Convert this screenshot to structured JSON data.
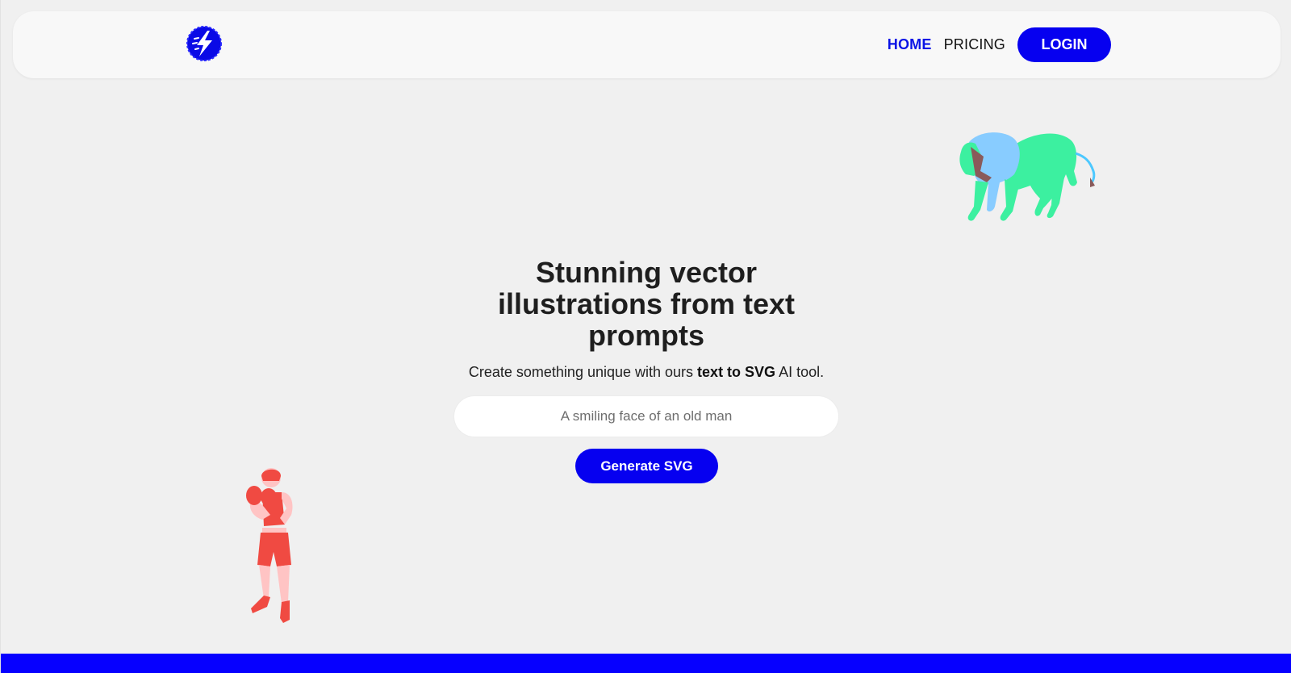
{
  "nav": {
    "home": "HOME",
    "pricing": "PRICING",
    "login": "LOGIN"
  },
  "hero": {
    "title": "Stunning vector illustrations from text prompts",
    "subtitle_prefix": "Create something unique with ours ",
    "subtitle_bold": "text to SVG",
    "subtitle_suffix": " AI tool.",
    "input_placeholder": "A smiling face of an old man",
    "generate_label": "Generate SVG"
  },
  "icons": {
    "logo": "lightning-bolt-logo-icon",
    "lion": "lion-illustration",
    "boxer": "boxer-illustration"
  },
  "colors": {
    "accent": "#0600f0",
    "home_link": "#0a14e6",
    "background": "#f0f0f0",
    "header": "#f8f8f8",
    "footer_bar": "#0600ff"
  }
}
